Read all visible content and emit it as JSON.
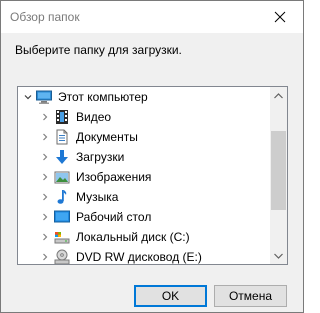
{
  "window": {
    "title": "Обзор папок"
  },
  "prompt": "Выберите папку для загрузки.",
  "tree": {
    "root": {
      "label": "Этот компьютер",
      "icon": "computer-icon"
    },
    "items": [
      {
        "label": "Видео",
        "icon": "video-icon"
      },
      {
        "label": "Документы",
        "icon": "documents-icon"
      },
      {
        "label": "Загрузки",
        "icon": "downloads-icon"
      },
      {
        "label": "Изображения",
        "icon": "pictures-icon"
      },
      {
        "label": "Музыка",
        "icon": "music-icon"
      },
      {
        "label": "Рабочий стол",
        "icon": "desktop-icon"
      },
      {
        "label": "Локальный диск (C:)",
        "icon": "local-disk-icon"
      },
      {
        "label": "DVD RW дисковод (E:)",
        "icon": "dvd-drive-icon"
      }
    ]
  },
  "buttons": {
    "ok": "OK",
    "cancel": "Отмена"
  },
  "colors": {
    "accent": "#0078d7",
    "title_text": "#7a7a7a"
  }
}
